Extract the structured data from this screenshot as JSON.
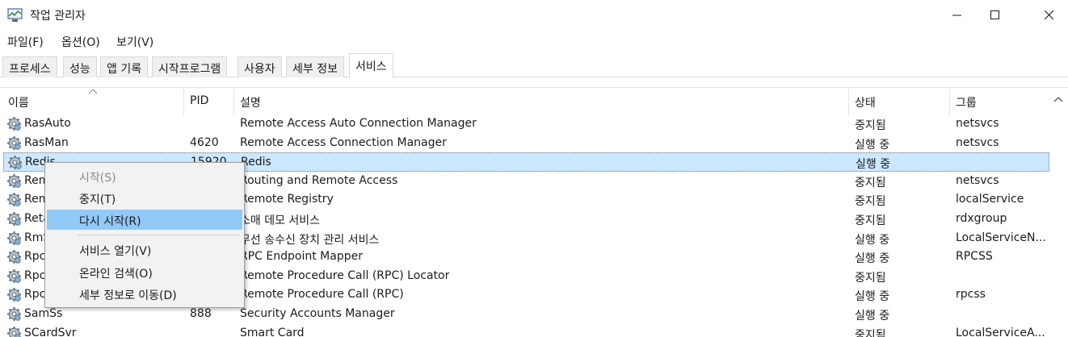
{
  "window": {
    "title": "작업 관리자",
    "app_icon": "task-manager-icon",
    "controls": [
      "minimize-icon",
      "maximize-icon",
      "close-icon"
    ]
  },
  "menu": [
    "파일(F)",
    "옵션(O)",
    "보기(V)"
  ],
  "tabs": [
    {
      "label": "프로세스",
      "active": false
    },
    {
      "label": "성능",
      "active": false
    },
    {
      "label": "앱 기록",
      "active": false
    },
    {
      "label": "시작프로그램",
      "active": false
    },
    {
      "label": "사용자",
      "active": false
    },
    {
      "label": "세부 정보",
      "active": false
    },
    {
      "label": "서비스",
      "active": true
    }
  ],
  "columns": {
    "name": "이름",
    "pid": "PID",
    "description": "설명",
    "status": "상태",
    "group": "그룹"
  },
  "rows": [
    {
      "name": "RasAuto",
      "pid": "",
      "description": "Remote Access Auto Connection Manager",
      "status": "중지됨",
      "group": "netsvcs"
    },
    {
      "name": "RasMan",
      "pid": "4620",
      "description": "Remote Access Connection Manager",
      "status": "실행 중",
      "group": "netsvcs"
    },
    {
      "name": "Redis",
      "pid": "15920",
      "description": "Redis",
      "status": "실행 중",
      "group": ""
    },
    {
      "name": "RemoteAccess",
      "pid": "",
      "description": "Routing and Remote Access",
      "status": "중지됨",
      "group": "netsvcs"
    },
    {
      "name": "RemoteRegistry",
      "pid": "",
      "description": "Remote Registry",
      "status": "중지됨",
      "group": "localService"
    },
    {
      "name": "RetailDemo",
      "pid": "",
      "description": "소매 데모 서비스",
      "status": "중지됨",
      "group": "rdxgroup"
    },
    {
      "name": "RmSvc",
      "pid": "",
      "description": "무선 송수신 장치 관리 서비스",
      "status": "실행 중",
      "group": "LocalServiceN..."
    },
    {
      "name": "RpcEptMapper",
      "pid": "",
      "description": "RPC Endpoint Mapper",
      "status": "실행 중",
      "group": "RPCSS"
    },
    {
      "name": "RpcLocator",
      "pid": "",
      "description": "Remote Procedure Call (RPC) Locator",
      "status": "중지됨",
      "group": ""
    },
    {
      "name": "RpcSs",
      "pid": "",
      "description": "Remote Procedure Call (RPC)",
      "status": "실행 중",
      "group": "rpcss"
    },
    {
      "name": "SamSs",
      "pid": "888",
      "description": "Security Accounts Manager",
      "status": "실행 중",
      "group": ""
    },
    {
      "name": "SCardSvr",
      "pid": "",
      "description": "Smart Card",
      "status": "중지됨",
      "group": "LocalServiceA..."
    }
  ],
  "context_menu": {
    "start": "시작(S)",
    "stop": "중지(T)",
    "restart": "다시 시작(R)",
    "open_services": "서비스 열기(V)",
    "search_online": "온라인 검색(O)",
    "go_to_details": "세부 정보로 이동(D)"
  },
  "colors": {
    "selected_row": "#cce8ff",
    "menu_hover": "#91c9f7"
  }
}
